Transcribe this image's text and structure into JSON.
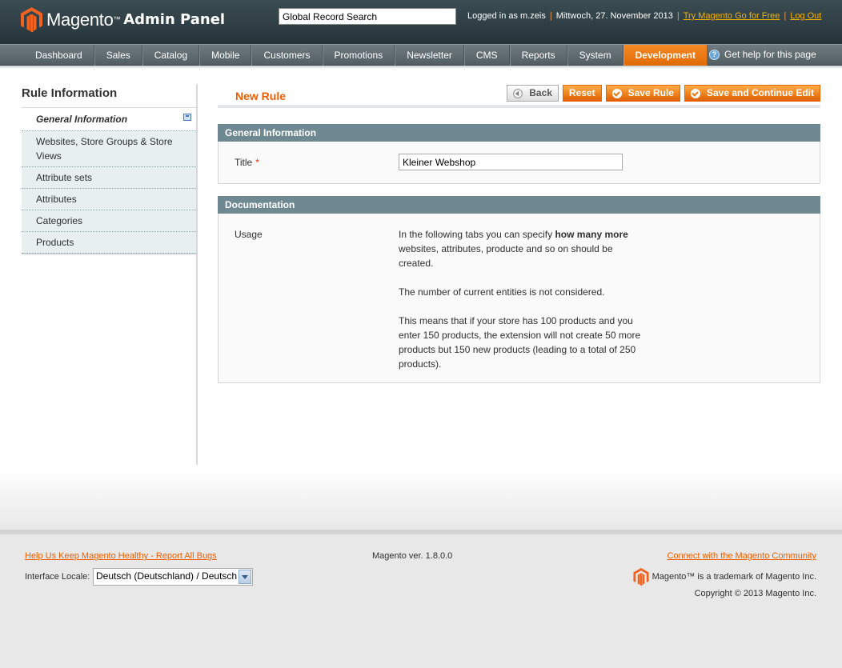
{
  "header": {
    "brand": "Magento",
    "brand_sub": "Admin Panel",
    "search_value": "Global Record Search",
    "logged_in": "Logged in as m.zeis",
    "date": "Mittwoch, 27. November 2013",
    "try_link": "Try Magento Go for Free",
    "logout": "Log Out"
  },
  "nav": {
    "items": [
      "Dashboard",
      "Sales",
      "Catalog",
      "Mobile",
      "Customers",
      "Promotions",
      "Newsletter",
      "CMS",
      "Reports",
      "System",
      "Development"
    ],
    "active": "Development",
    "help": "Get help for this page"
  },
  "sidebar": {
    "title": "Rule Information",
    "tabs": [
      "General Information",
      "Websites, Store Groups & Store Views",
      "Attribute sets",
      "Attributes",
      "Categories",
      "Products"
    ]
  },
  "page": {
    "title": "New Rule",
    "buttons": {
      "back": "Back",
      "reset": "Reset",
      "save": "Save Rule",
      "save_continue": "Save and Continue Edit"
    }
  },
  "general": {
    "heading": "General Information",
    "title_label": "Title",
    "title_required": "*",
    "title_value": "Kleiner Webshop"
  },
  "documentation": {
    "heading": "Documentation",
    "usage_label": "Usage",
    "p1_pre": "In the following tabs you can specify ",
    "p1_bold": "how many more",
    "p1_post": " websites, attributes, producte and so on should be created.",
    "p2": "The number of current entities is not considered.",
    "p3": "This means that if your store has 100 products and you enter 150 products, the extension will not create 50 more products but 150 new products (leading to a total of 250 products)."
  },
  "footer": {
    "bugs_link": "Help Us Keep Magento Healthy - Report All Bugs",
    "locale_label": "Interface Locale:",
    "locale_value": "Deutsch (Deutschland) / Deutsch",
    "version": "Magento ver. 1.8.0.0",
    "community_link": "Connect with the Magento Community",
    "trademark": "Magento™ is a trademark of Magento Inc.",
    "copyright": "Copyright © 2013 Magento Inc."
  },
  "colors": {
    "accent": "#eb5e00",
    "header_bg": "#2c3a40",
    "section_head": "#6f8992"
  }
}
